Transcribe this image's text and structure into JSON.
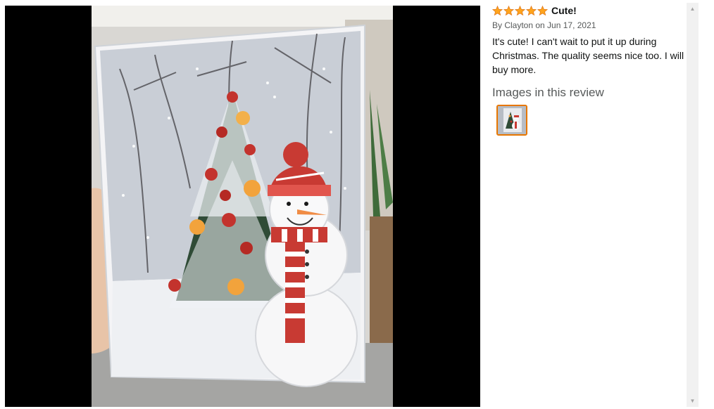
{
  "review": {
    "rating": 5,
    "title": "Cute!",
    "byline": "By Clayton on Jun 17, 2021",
    "body": "It's cute! I can't wait to put it up during Christmas. The quality seems nice too. I will buy more.",
    "images_heading": "Images in this review"
  },
  "colors": {
    "star": "#ffa41c",
    "star_outline": "#de7921",
    "thumb_border": "#e77600",
    "viewer_bg": "#000000"
  },
  "icons": {
    "star": "star-icon",
    "scroll_up": "scroll-up-icon",
    "scroll_down": "scroll-down-icon"
  }
}
